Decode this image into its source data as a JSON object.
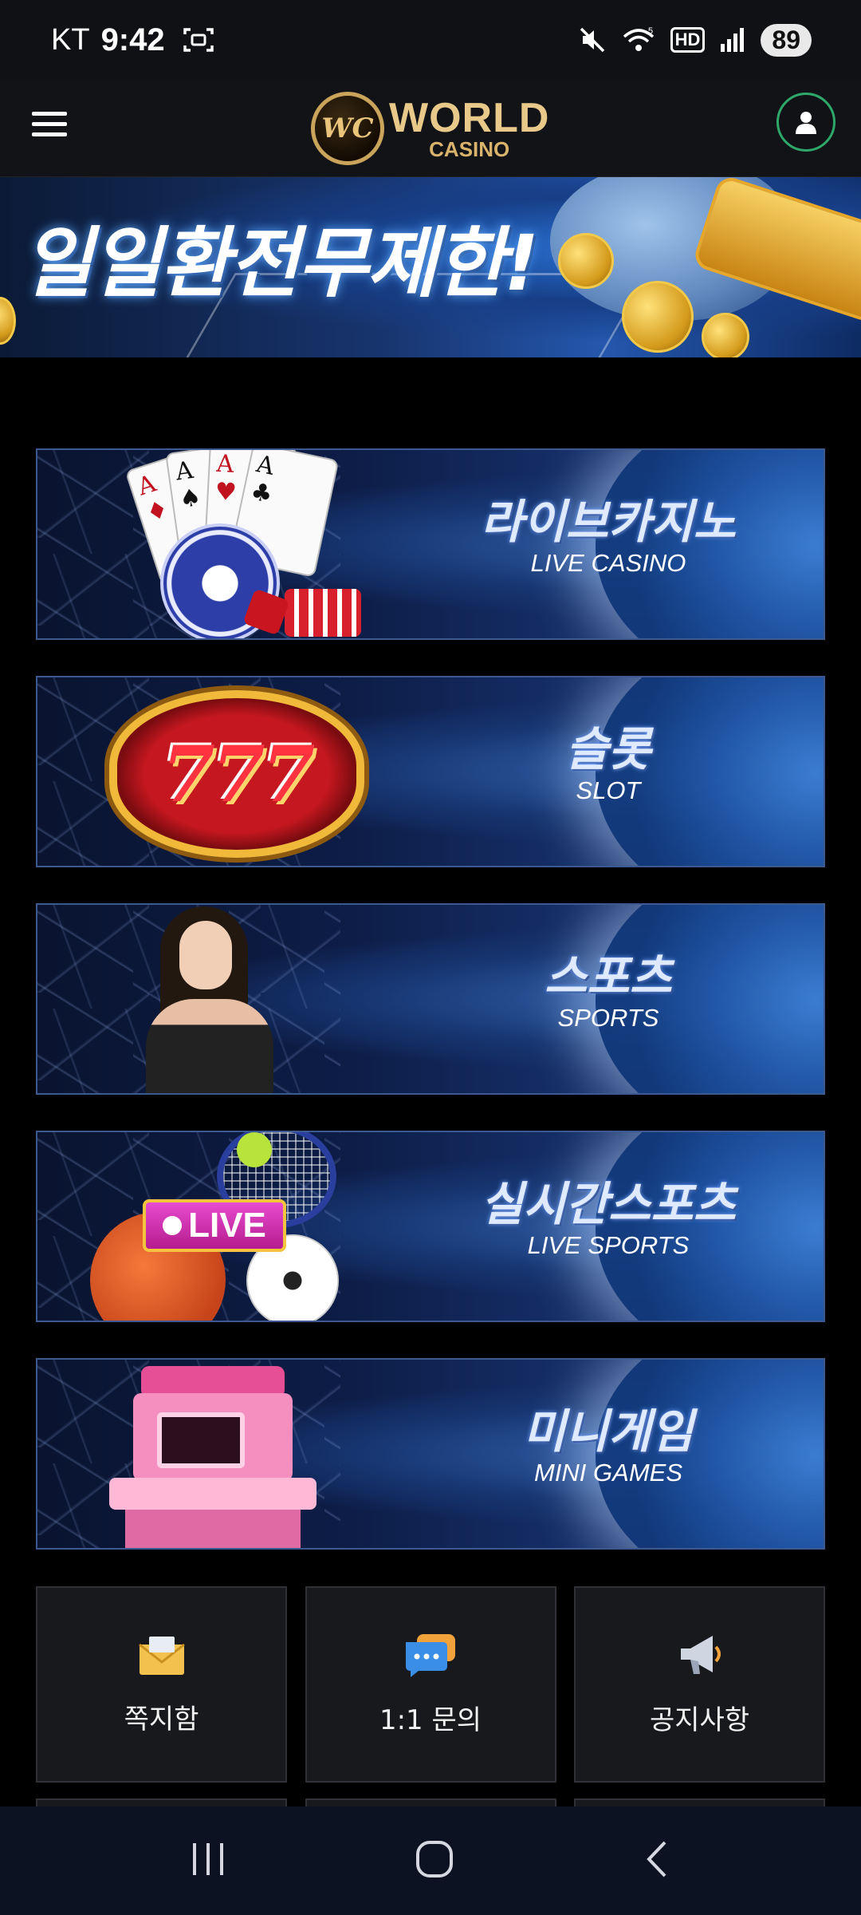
{
  "status_bar": {
    "carrier": "KT",
    "time": "9:42",
    "network_tag": "5",
    "hd_label": "HD",
    "battery": "89"
  },
  "header": {
    "logo_mark": "WC",
    "logo_title": "WORLD",
    "logo_subtitle": "CASINO"
  },
  "promo_banner": {
    "headline": "일일환전무제한!"
  },
  "categories": [
    {
      "title_ko": "라이브카지노",
      "title_en": "LIVE CASINO"
    },
    {
      "title_ko": "슬롯",
      "title_en": "SLOT"
    },
    {
      "title_ko": "스포츠",
      "title_en": "SPORTS"
    },
    {
      "title_ko": "실시간스포츠",
      "title_en": "LIVE SPORTS"
    },
    {
      "title_ko": "미니게임",
      "title_en": "MINI GAMES"
    }
  ],
  "slot_sign_text": "777",
  "live_badge_text": "LIVE",
  "quick_menu": [
    {
      "label": "쪽지함",
      "icon": "envelope-icon"
    },
    {
      "label": "1:1 문의",
      "icon": "chat-bubble-icon"
    },
    {
      "label": "공지사항",
      "icon": "megaphone-icon"
    }
  ],
  "colors": {
    "background": "#000000",
    "header": "#121317",
    "user_button_ring": "#2ea86a",
    "logo_gold": "#e9c98a",
    "tile": "#18191d",
    "nav_bar": "#0c1222"
  }
}
